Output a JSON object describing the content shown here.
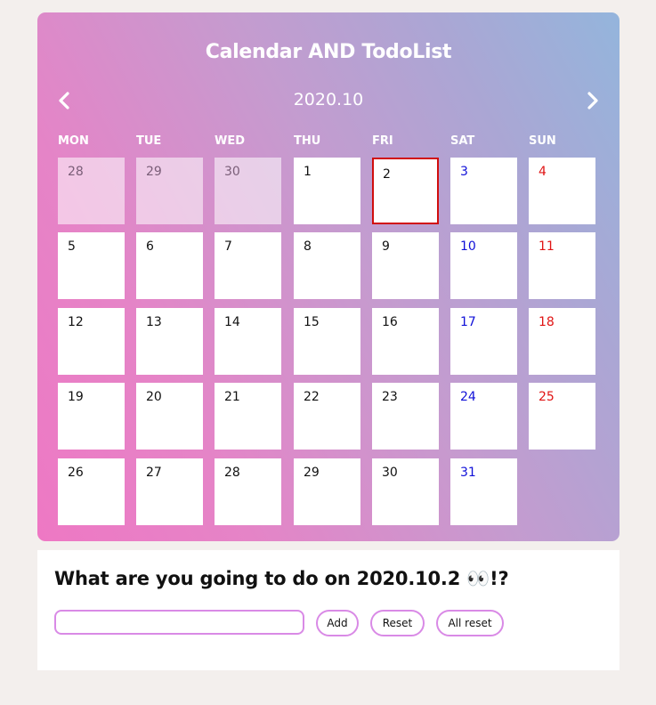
{
  "header": {
    "title": "Calendar AND TodoList",
    "month": "2020.10"
  },
  "weekdays": [
    "MON",
    "TUE",
    "WED",
    "THU",
    "FRI",
    "SAT",
    "SUN"
  ],
  "days": [
    "28",
    "29",
    "30",
    "1",
    "2",
    "3",
    "4",
    "5",
    "6",
    "7",
    "8",
    "9",
    "10",
    "11",
    "12",
    "13",
    "14",
    "15",
    "16",
    "17",
    "18",
    "19",
    "20",
    "21",
    "22",
    "23",
    "24",
    "25",
    "26",
    "27",
    "28",
    "29",
    "30",
    "31"
  ],
  "todo": {
    "heading": "What are you going to do on 2020.10.2 👀!?",
    "input_value": "",
    "input_placeholder": "",
    "add_label": "Add",
    "reset_label": "Reset",
    "all_reset_label": "All reset"
  },
  "colors": {
    "saturday": "#1010d8",
    "sunday": "#e01414",
    "selected_border": "#d10d0d",
    "accent": "#d98ae6"
  },
  "icons": {
    "prev": "chevron-left-icon",
    "next": "chevron-right-icon"
  }
}
